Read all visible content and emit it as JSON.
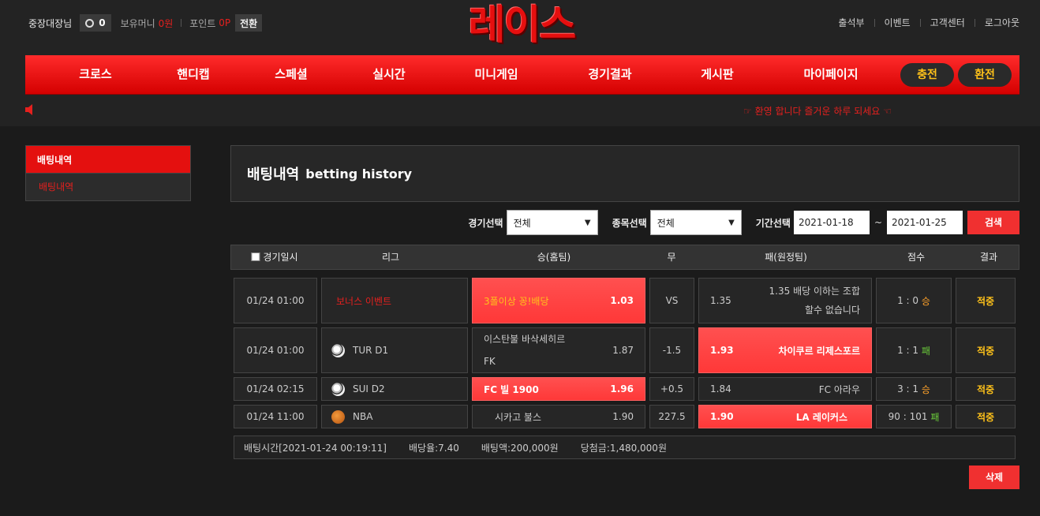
{
  "user": {
    "name": "중장대장님",
    "level": "0",
    "money_label": "보유머니",
    "money": "0원",
    "point_label": "포인트",
    "point": "0P",
    "convert": "전환"
  },
  "logo": "레이스",
  "top_links": [
    "출석부",
    "이벤트",
    "고객센터",
    "로그아웃"
  ],
  "nav": [
    "크로스",
    "핸디캡",
    "스페셜",
    "실시간",
    "미니게임",
    "경기결과",
    "게시판",
    "마이페이지"
  ],
  "charge": "충전",
  "withdraw": "환전",
  "ticker": "☞ 환영 합니다 즐거운 하루 되세요 ☜",
  "sidebar": {
    "header": "배팅내역",
    "item": "배팅내역"
  },
  "page": {
    "title_ko": "배팅내역",
    "title_en": "betting history"
  },
  "filter": {
    "game_label": "경기선택",
    "game_value": "전체",
    "sport_label": "종목선택",
    "sport_value": "전체",
    "period_label": "기간선택",
    "date_from": "2021-01-18",
    "tilde": "~",
    "date_to": "2021-01-25",
    "search": "검색"
  },
  "table_headers": [
    "경기일시",
    "리그",
    "승(홈팀)",
    "무",
    "패(원정팀)",
    "점수",
    "결과"
  ],
  "rows": [
    {
      "time": "01/24 01:00",
      "league": "보너스 이벤트",
      "home": "3폴이상 꽁!배당",
      "home_odds": "1.03",
      "draw": "VS",
      "away_odds": "1.35",
      "away": "1.35 배당 이하는 조합 할수 없습니다",
      "score": "1 : 0",
      "wl": "승",
      "result": "적중"
    },
    {
      "time": "01/24 01:00",
      "league": "TUR D1",
      "home": "이스탄불 바삭세히르 FK",
      "home_odds": "1.87",
      "draw": "-1.5",
      "away_odds": "1.93",
      "away": "차이쿠르 리제스포르",
      "score": "1 : 1",
      "wl": "패",
      "result": "적중"
    },
    {
      "time": "01/24 02:15",
      "league": "SUI D2",
      "home": "FC 빌 1900",
      "home_odds": "1.96",
      "draw": "+0.5",
      "away_odds": "1.84",
      "away": "FC 아라우",
      "score": "3 : 1",
      "wl": "승",
      "result": "적중"
    },
    {
      "time": "01/24 11:00",
      "league": "NBA",
      "home": "시카고 불스",
      "home_odds": "1.90",
      "draw": "227.5",
      "away_odds": "1.90",
      "away": "LA 레이커스",
      "score": "90 : 101",
      "wl": "패",
      "result": "적중"
    }
  ],
  "summary": {
    "bet_time": "배팅시간[2021-01-24 00:19:11]",
    "rate": "배당율:7.40",
    "amount": "배팅액:200,000원",
    "win": "당첨금:1,480,000원"
  },
  "delete": "삭제",
  "colors": {
    "accent": "#e4100f",
    "gold": "#ffc21a",
    "win": "#ffa22a",
    "lose": "#6ccf3b",
    "bg": "#1b1b1b"
  },
  "icons": [
    "speaker-icon",
    "soccer-ball-icon",
    "basketball-icon",
    "checkbox-icon",
    "chevron-down-icon",
    "level-badge-icon"
  ]
}
